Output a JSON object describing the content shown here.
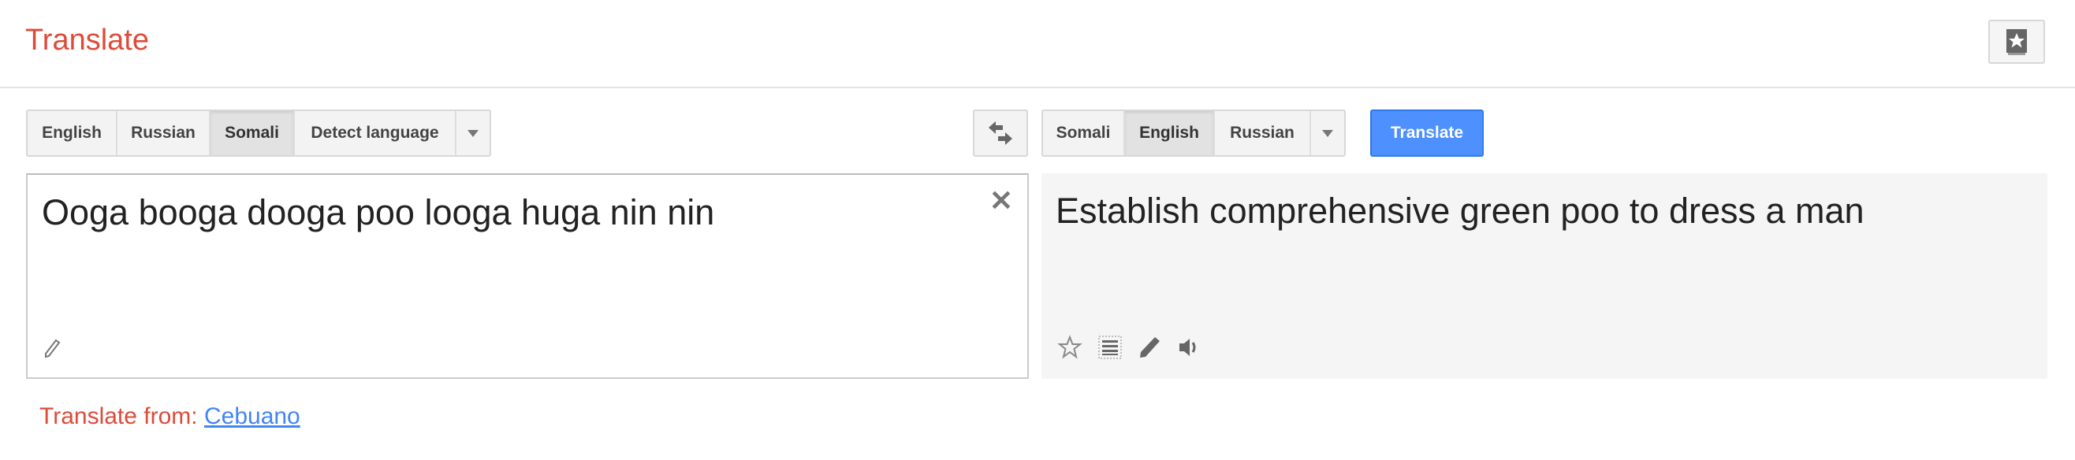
{
  "header": {
    "title": "Translate",
    "bookmark_icon": "phrasebook-star-icon"
  },
  "source_languages": {
    "items": [
      "English",
      "Russian",
      "Somali",
      "Detect language"
    ],
    "selected": "Somali"
  },
  "target_languages": {
    "items": [
      "Somali",
      "English",
      "Russian"
    ],
    "selected": "English"
  },
  "translate_button": "Translate",
  "source": {
    "text": "Ooga booga dooga poo looga huga nin nin"
  },
  "target": {
    "text": "Establish comprehensive green poo to dress a man"
  },
  "suggestion": {
    "label": "Translate from:",
    "language": "Cebuano"
  },
  "colors": {
    "accent": "#dd4b39",
    "button": "#4d90fe",
    "link": "#4285f4"
  }
}
